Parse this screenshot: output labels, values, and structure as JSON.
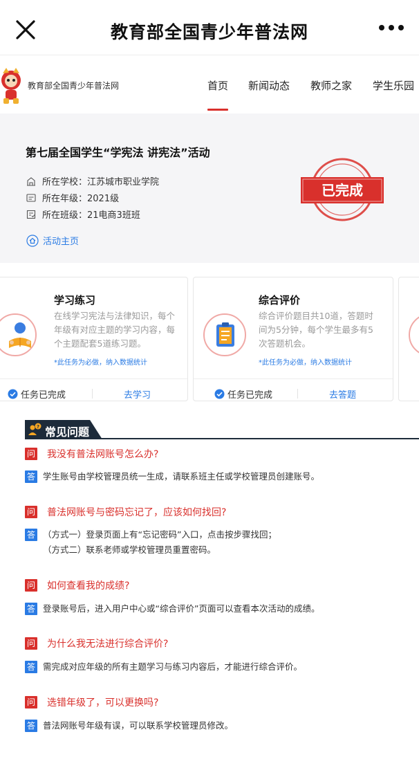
{
  "window": {
    "title": "教育部全国青少年普法网"
  },
  "site": {
    "name": "教育部全国青少年普法网",
    "nav": [
      "首页",
      "新闻动态",
      "教师之家",
      "学生乐园"
    ]
  },
  "activity": {
    "title": "第七届全国学生“学宪法 讲宪法”活动",
    "school": "所在学校：江苏城市职业学院",
    "grade": "所在年级：2021级",
    "class": "所在班级：21电商3班班",
    "home_link": "活动主页",
    "status_stamp": "已完成"
  },
  "cards": [
    {
      "title": "学习练习",
      "desc_lines": [
        "在线学习宪法与法律知识，每个",
        "年级有对应主题的学习内容，每",
        "个主题配套5道练习题。"
      ],
      "note": "*此任务为必做，纳入数据统计",
      "status": "任务已完成",
      "action": "去学习"
    },
    {
      "title": "综合评价",
      "desc_lines": [
        "综合评价题目共10道，答题时",
        "间为5分钟，每个学生最多有5",
        "次答题机会。"
      ],
      "note": "*此任务为必做，纳入数据统计",
      "status": "任务已完成",
      "action": "去答题"
    }
  ],
  "faq": {
    "heading": "常见问题",
    "q_badge": "问",
    "a_badge": "答",
    "items": [
      {
        "q": "我没有普法网账号怎么办?",
        "a": [
          "学生账号由学校管理员统一生成，请联系班主任或学校管理员创建账号。"
        ]
      },
      {
        "q": "普法网账号与密码忘记了，应该如何找回?",
        "a": [
          "（方式一）登录页面上有“忘记密码”入口，点击按步骤找回；",
          "（方式二）联系老师或学校管理员重置密码。"
        ]
      },
      {
        "q": "如何查看我的成绩?",
        "a": [
          "登录账号后，进入用户中心或“综合评价”页面可以查看本次活动的成绩。"
        ]
      },
      {
        "q": "为什么我无法进行综合评价?",
        "a": [
          "需完成对应年级的所有主题学习与练习内容后，才能进行综合评价。"
        ]
      },
      {
        "q": "选错年级了，可以更换吗?",
        "a": [
          "普法网账号年级有误，可以联系学校管理员修改。"
        ]
      }
    ]
  },
  "colors": {
    "accent_red": "#d9302c",
    "link_blue": "#2a7be4",
    "faq_dark": "#1d2b3a"
  }
}
